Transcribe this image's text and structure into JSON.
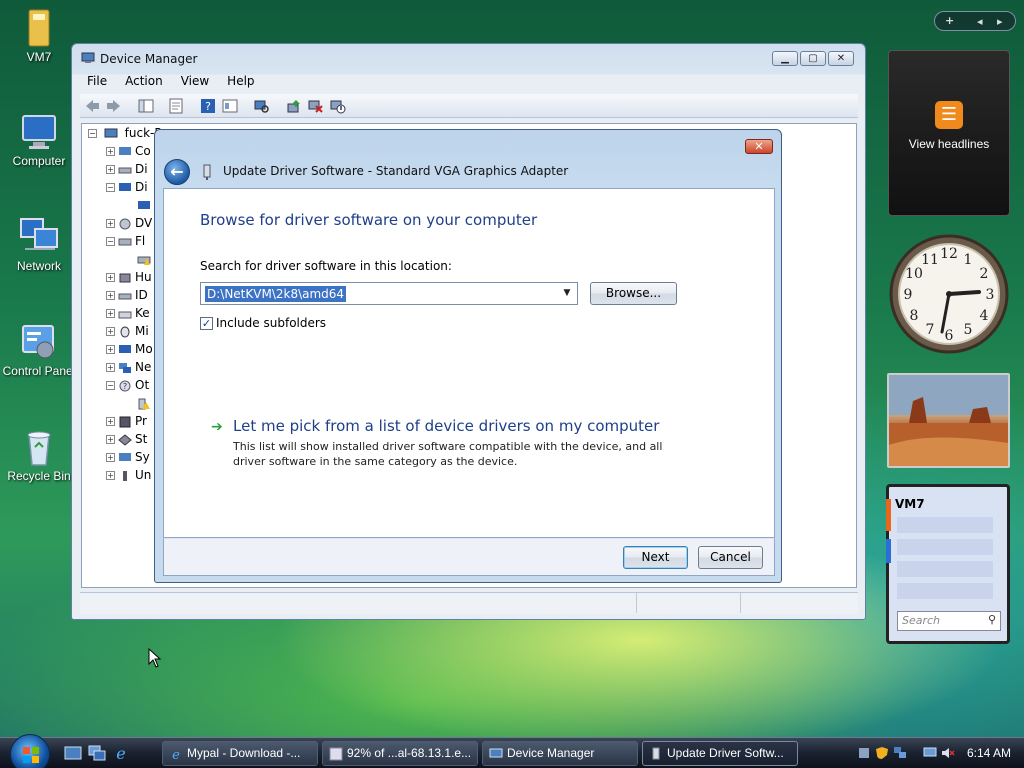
{
  "desktop": {
    "icons": [
      {
        "label": "VM7"
      },
      {
        "label": "Computer"
      },
      {
        "label": "Network"
      },
      {
        "label": "Control Panel"
      },
      {
        "label": "Recycle Bin"
      }
    ]
  },
  "gadgets": {
    "news_label": "View headlines",
    "notes_title": "VM7",
    "search_placeholder": "Search",
    "clock_numbers": [
      "12",
      "1",
      "2",
      "3",
      "4",
      "5",
      "6",
      "7",
      "8",
      "9",
      "10",
      "11"
    ]
  },
  "device_manager": {
    "title": "Device Manager",
    "menu": [
      "File",
      "Action",
      "View",
      "Help"
    ],
    "tree_root": "fuck-P",
    "tree_items": [
      "Co",
      "Di",
      "Di",
      "",
      "DV",
      "Fl",
      "",
      "Hu",
      "ID",
      "Ke",
      "Mi",
      "Mo",
      "Ne",
      "Ot",
      "",
      "Pr",
      "St",
      "Sy",
      "Un"
    ]
  },
  "dialog": {
    "caption": "Update Driver Software - Standard VGA Graphics Adapter",
    "heading": "Browse for driver software on your computer",
    "search_label": "Search for driver software in this location:",
    "path_value": "D:\\NetKVM\\2k8\\amd64",
    "browse_label": "Browse...",
    "include_subfolders": "Include subfolders",
    "pick_title": "Let me pick from a list of device drivers on my computer",
    "pick_desc": "This list will show installed driver software compatible with the device, and all driver software in the same category as the device.",
    "next_label": "Next",
    "cancel_label": "Cancel"
  },
  "taskbar": {
    "tasks": [
      {
        "label": "Mypal - Download -..."
      },
      {
        "label": "92% of ...al-68.13.1.e..."
      },
      {
        "label": "Device Manager"
      },
      {
        "label": "Update Driver Softw..."
      }
    ],
    "time": "6:14 AM"
  },
  "colors": {
    "accent_blue": "#1e3f8a",
    "link_green": "#2ca03c",
    "close_red": "#c9452a"
  }
}
